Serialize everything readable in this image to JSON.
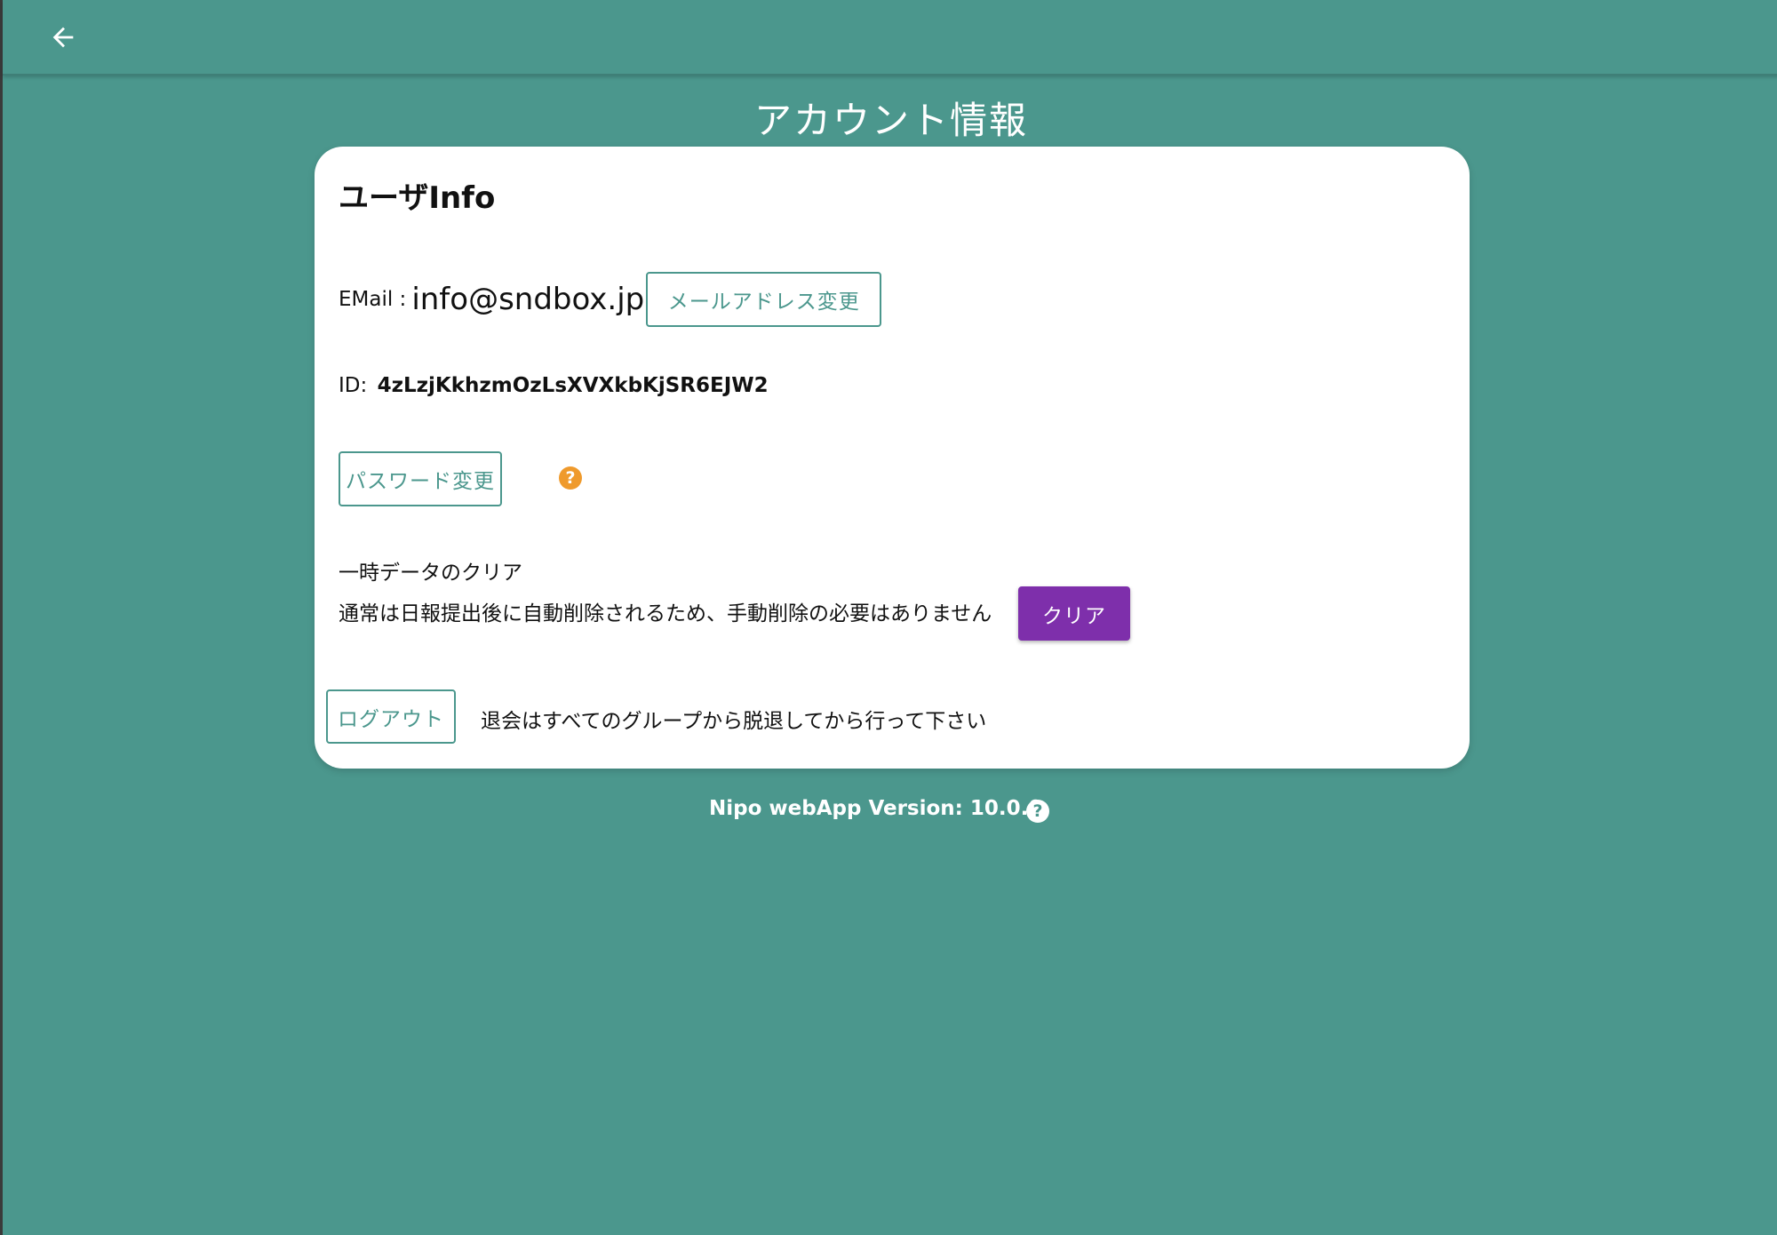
{
  "header": {
    "back_icon": "arrow-left-icon"
  },
  "page": {
    "title": "アカウント情報"
  },
  "card": {
    "title": "ユーザInfo",
    "email_label": "EMail :",
    "email_value": "info@sndbox.jp",
    "email_change_button": "メールアドレス変更",
    "id_label": "ID:",
    "id_value": "4zLzjKkhzmOzLsXVXkbKjSR6EJW2",
    "password_change_button": "パスワード変更",
    "password_help_icon": "?",
    "clear_title": "一時データのクリア",
    "clear_description": "通常は日報提出後に自動削除されるため、手動削除の必要はありません",
    "clear_button": "クリア",
    "logout_button": "ログアウト",
    "withdraw_note": "退会はすべてのグループから脱退してから行って下さい"
  },
  "footer": {
    "version_text": "Nipo webApp Version: 10.0.0",
    "help_icon": "?"
  },
  "colors": {
    "background": "#4b978d",
    "accent": "#4b978d",
    "clear_button": "#7e2fab",
    "help_orange": "#ef9a2c"
  }
}
